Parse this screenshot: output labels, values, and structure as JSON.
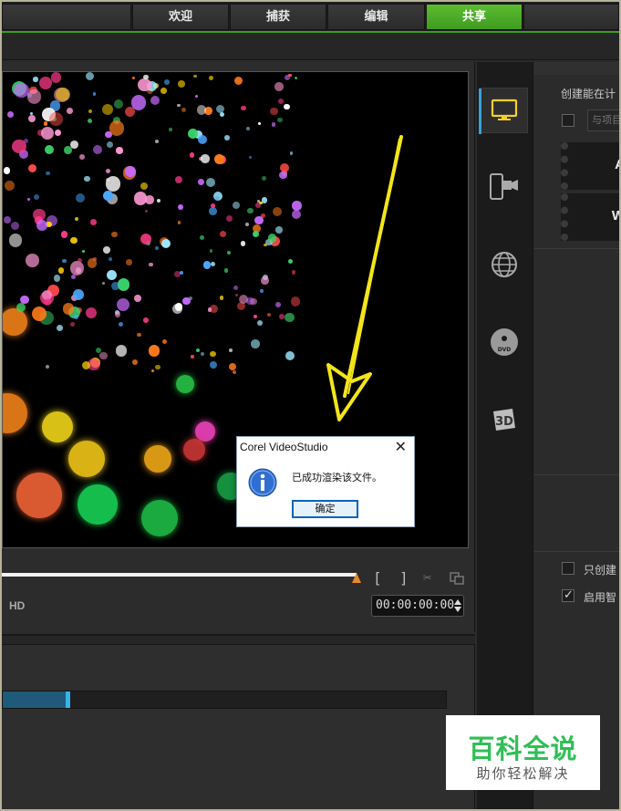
{
  "tabs": [
    {
      "label": "欢迎",
      "active": false
    },
    {
      "label": "捕获",
      "active": false
    },
    {
      "label": "编辑",
      "active": false
    },
    {
      "label": "共享",
      "active": true
    }
  ],
  "colors": {
    "accent_green": "#3f9b1f",
    "scrub_marker": "#e8892b",
    "progress_handle": "#37b3e8",
    "annotation_arrow": "#f3e51a",
    "watermark_green": "#2fbf56"
  },
  "preview": {
    "resolution_label": "HD",
    "timecode": "00:00:00:00",
    "scrub_progress": 0.76,
    "render_progress": 0.15
  },
  "side_icons": [
    {
      "name": "computer-icon",
      "selected": true
    },
    {
      "name": "mobile-device-icon",
      "selected": false
    },
    {
      "name": "web-globe-icon",
      "selected": false
    },
    {
      "name": "dvd-disc-icon",
      "selected": false
    },
    {
      "name": "3d-icon",
      "selected": false
    }
  ],
  "options": {
    "title": "创建能在计",
    "match_project_placeholder": "与项目",
    "format_tiles": [
      "A",
      "W"
    ],
    "only_create_label": "只创建",
    "only_create_checked": false,
    "smart_render_label": "启用智",
    "smart_render_checked": true
  },
  "dialog": {
    "title": "Corel VideoStudio",
    "close_glyph": "✕",
    "message": "已成功渲染该文件。",
    "ok_label": "确定"
  },
  "watermark": {
    "main": "百科全说",
    "sub": "助你轻松解决"
  }
}
